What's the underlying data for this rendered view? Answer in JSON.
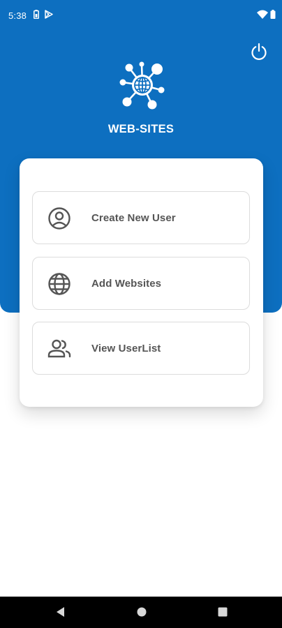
{
  "status_bar": {
    "time": "5:38",
    "icons": [
      "battery-saver-icon",
      "play-store-icon",
      "wifi-icon",
      "battery-icon"
    ]
  },
  "header": {
    "app_title": "WEB-SITES",
    "logo_icon": "network-globe-logo",
    "power_icon": "power-icon"
  },
  "menu": {
    "items": [
      {
        "label": "Create New User",
        "icon": "user-circle-icon"
      },
      {
        "label": "Add Websites",
        "icon": "globe-icon"
      },
      {
        "label": "View UserList",
        "icon": "users-icon"
      }
    ]
  },
  "nav_bar": {
    "icons": [
      "back-icon",
      "home-icon",
      "recents-icon"
    ]
  },
  "colors": {
    "primary": "#0d6fc0",
    "text": "#555555",
    "border": "#dcdcdc"
  }
}
